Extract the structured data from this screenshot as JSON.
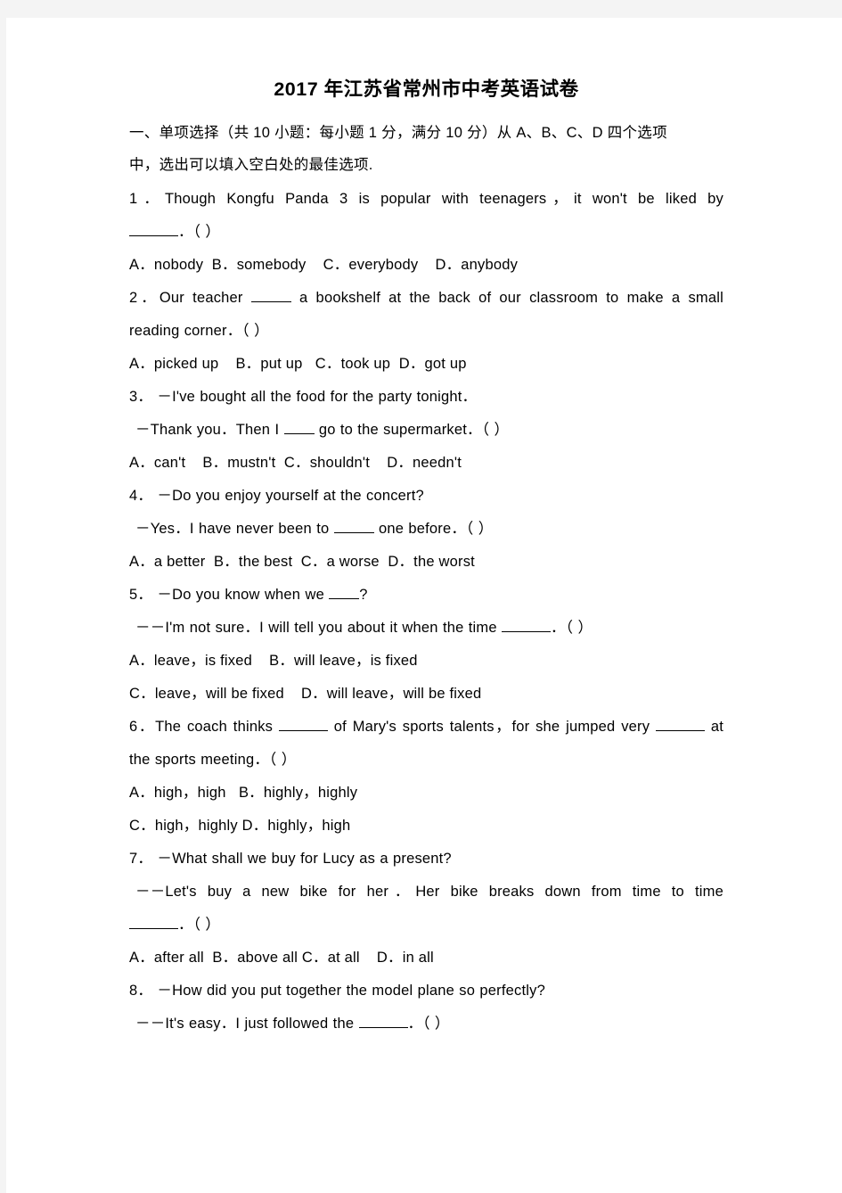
{
  "document": {
    "title": "2017 年江苏省常州市中考英语试卷",
    "section_heading_line1": "一、单项选择（共  10 小题：每小题  1 分，满分 10 分）从 A、B、C、D 四个选项",
    "section_heading_line2": "中，选出可以填入空白处的最佳选项."
  },
  "questions": [
    {
      "number": "1．",
      "stem_line1": "Though  Kongfu  Panda 3 is  popular  with  teenagers，it  won't  be  liked  by",
      "stem_line2_suffix": "．（    ）",
      "options_lines": [
        "A．nobody  B．somebody    C．everybody    D．anybody"
      ]
    },
    {
      "number": "2．",
      "stem_line1_pre": "Our teacher",
      "stem_line1_post": "a bookshelf at the back of  our classroom to make a small",
      "stem_line2": "reading corner．（    ）",
      "options_lines": [
        "A．picked up    B．put up   C．took up  D．got up"
      ]
    },
    {
      "number": "3．",
      "stem_line1": "－I've bought all the food for the party tonight．",
      "stem_line2_pre": "－Thank you．Then I",
      "stem_line2_post": "go to the supermarket．（    ）",
      "options_lines": [
        "A．can't    B．mustn't  C．shouldn't    D．needn't"
      ]
    },
    {
      "number": "4．",
      "stem_line1": "－Do you enjoy yourself at the concert?",
      "stem_line2_pre": "－Yes．I have never been to",
      "stem_line2_post": "one before．（    ）",
      "options_lines": [
        "A．a better  B．the best  C．a worse  D．the worst"
      ]
    },
    {
      "number": "5．",
      "stem_line1_pre": "－Do you know when we",
      "stem_line1_post": "?",
      "stem_line2_pre": "－－I'm not sure．I will tell you about it when the time",
      "stem_line2_post": "．（    ）",
      "options_lines": [
        "A．leave，is fixed    B．will leave，is fixed",
        "C．leave，will be fixed    D．will leave，will be fixed"
      ]
    },
    {
      "number": "6．",
      "stem_line1_pre": "The coach thinks",
      "stem_line1_mid": "of Mary's sports talents，for she jumped very",
      "stem_line1_post": "at",
      "stem_line2": "the sports meeting．（    ）",
      "options_lines": [
        "A．high，high   B．highly，highly",
        "C．high，highly D．highly，high"
      ]
    },
    {
      "number": "7．",
      "stem_line1": "－What shall we buy for Lucy as a present?",
      "stem_line2": "－－Let's buy  a  new  bike  for her．Her  bike  breaks down  from  time  to  time",
      "stem_line3_suffix": "．（    ）",
      "options_lines": [
        "A．after all  B．above all C．at all    D．in all"
      ]
    },
    {
      "number": "8．",
      "stem_line1": "－How did you put together the model plane so perfectly?",
      "stem_line2_pre": "－－It's easy．I just followed the",
      "stem_line2_post": "．（    ）",
      "options_lines": []
    }
  ]
}
